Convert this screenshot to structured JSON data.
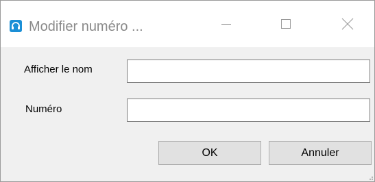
{
  "window": {
    "title": "Modifier numéro ...",
    "icon": "headset-icon",
    "title_color": "#8a8a8a",
    "accent_color": "#1b8fd6"
  },
  "caption_buttons": {
    "minimize_icon": "minimize-icon",
    "maximize_icon": "maximize-icon",
    "close_icon": "close-icon"
  },
  "form": {
    "display_name_label": "Afficher le nom",
    "display_name_value": "",
    "number_label": "Numéro",
    "number_value": ""
  },
  "buttons": {
    "ok_label": "OK",
    "cancel_label": "Annuler"
  }
}
